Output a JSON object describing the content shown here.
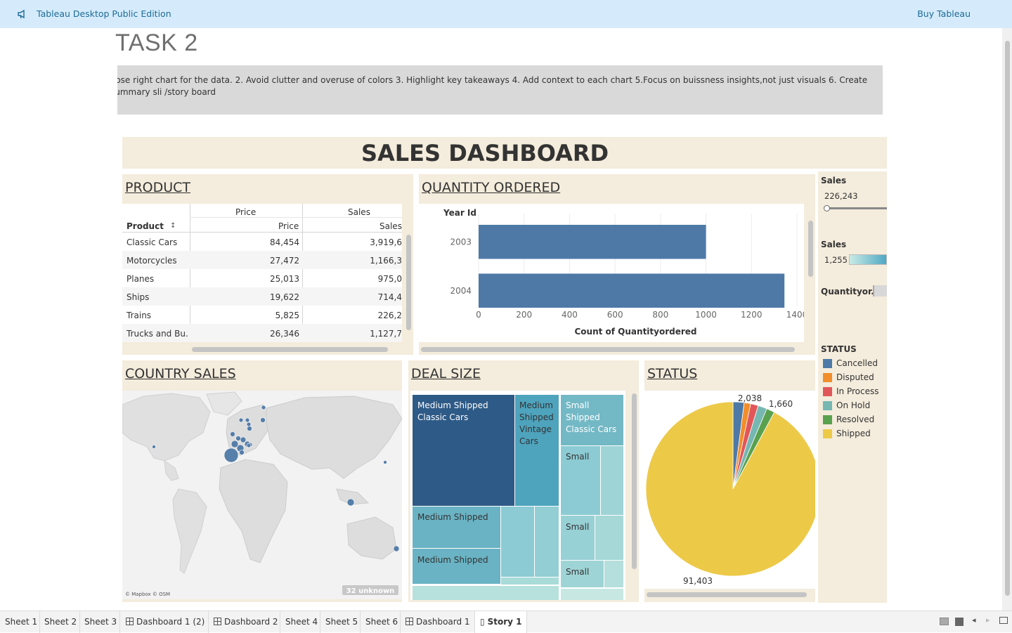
{
  "app": {
    "title": "Tableau Desktop Public Edition",
    "buy_label": "Buy Tableau"
  },
  "story": {
    "title": "TASK 2",
    "caption": "oose right chart for the data.  2. Avoid clutter and overuse of colors   3.  Highlight key takeaways  4. Add context to each chart   5.Focus on buissness insights,not just visuals   6. Create summary sli /story board"
  },
  "dashboard": {
    "title": "SALES DASHBOARD"
  },
  "product": {
    "title": "PRODUCT",
    "col_header_top": [
      "Price",
      "Sales"
    ],
    "col_header": [
      "Product",
      "Price",
      "Sales"
    ],
    "rows": [
      {
        "product": "Classic Cars",
        "price": "84,454",
        "sales": "3,919,6"
      },
      {
        "product": "Motorcycles",
        "price": "27,472",
        "sales": "1,166,3"
      },
      {
        "product": "Planes",
        "price": "25,013",
        "sales": "975,0"
      },
      {
        "product": "Ships",
        "price": "19,622",
        "sales": "714,4"
      },
      {
        "product": "Trains",
        "price": "5,825",
        "sales": "226,2"
      },
      {
        "product": "Trucks and Bu..",
        "price": "26,346",
        "sales": "1,127,7"
      }
    ]
  },
  "quantity": {
    "title": "QUANTITY ORDERED ",
    "row_header": "Year Id",
    "chart_data": {
      "type": "bar",
      "orientation": "horizontal",
      "categories": [
        "2003",
        "2004"
      ],
      "values": [
        1000,
        1345
      ],
      "xlabel": "Count of Quantityordered",
      "ylabel": "Year Id",
      "xlim": [
        0,
        1400
      ],
      "ticks": [
        "0",
        "200",
        "400",
        "600",
        "800",
        "1000",
        "1200",
        "1400"
      ],
      "color": "#4e79a7",
      "grid": true
    }
  },
  "country": {
    "title": "COUNTRY SALES",
    "attribution": "© Mapbox © OSM",
    "unknown_badge": "32 unknown"
  },
  "deal_size": {
    "title": "DEAL SIZE ",
    "labels": {
      "a": "Medium Shipped Classic Cars",
      "b": "Medium Shipped Vintage Cars",
      "c": "Small Shipped Classic Cars",
      "d": "Medium Shipped",
      "e": "Medium Shipped",
      "f": "Small",
      "g": "Small",
      "h": "Small"
    }
  },
  "status": {
    "title": "STATUS",
    "chart_data": {
      "type": "pie",
      "categories": [
        "Cancelled",
        "Disputed",
        "In Process",
        "On Hold",
        "Resolved",
        "Shipped"
      ],
      "values": [
        2038,
        1200,
        1400,
        1660,
        1500,
        91403
      ],
      "colors": [
        "#4e79a7",
        "#f28e2b",
        "#e15759",
        "#76b7b2",
        "#59a14f",
        "#edc948"
      ],
      "data_labels": [
        "2,038",
        "1,660",
        "91,403"
      ]
    }
  },
  "filters": {
    "sales_slider_label": "Sales",
    "sales_slider_value": "226,243",
    "sales_color_label": "Sales",
    "sales_color_value": "1,255",
    "quantity_label": "Quantityor..",
    "status_label": "STATUS",
    "status_items": [
      {
        "name": "Cancelled",
        "color": "#4e79a7"
      },
      {
        "name": "Disputed",
        "color": "#f28e2b"
      },
      {
        "name": "In Process",
        "color": "#e15759"
      },
      {
        "name": "On Hold",
        "color": "#76b7b2"
      },
      {
        "name": "Resolved",
        "color": "#59a14f"
      },
      {
        "name": "Shipped",
        "color": "#edc948"
      }
    ]
  },
  "tabs": [
    "Sheet 1",
    "Sheet 2",
    "Sheet 3",
    "Dashboard 1 (2)",
    "Dashboard 2",
    "Sheet 4",
    "Sheet 5",
    "Sheet 6",
    "Dashboard 1",
    "Story 1"
  ],
  "active_tab": "Story 1"
}
